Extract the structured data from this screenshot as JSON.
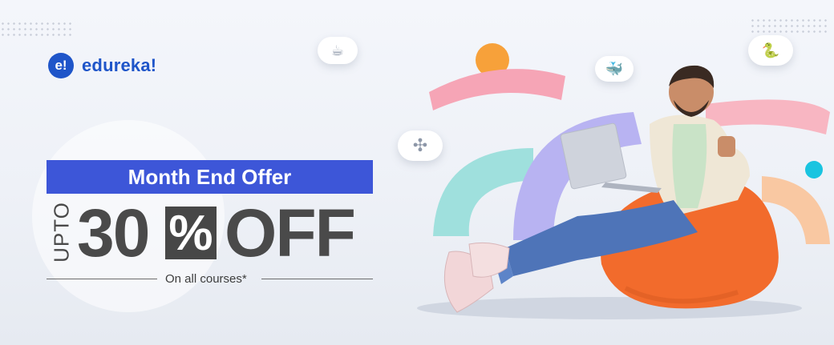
{
  "brand": {
    "badge": "e!",
    "name": "edureka!"
  },
  "offer": {
    "headline": "Month End Offer",
    "prefix": "UPTO",
    "number": "30",
    "percent": "%",
    "suffix": "OFF",
    "note": "On all courses*"
  },
  "icons": [
    "java-cloud-icon",
    "docker-cloud-icon",
    "python-cloud-icon",
    "tableau-cloud-icon"
  ],
  "colors": {
    "brand_blue": "#1f55c9",
    "offer_bg": "#3d56d8",
    "text_dark": "#4a4a4a",
    "pink": "#f6a5b6",
    "orange": "#f7a13a",
    "teal": "#9fe0dd",
    "lavender": "#b8b3f2",
    "beanbag": "#f26b2c"
  }
}
